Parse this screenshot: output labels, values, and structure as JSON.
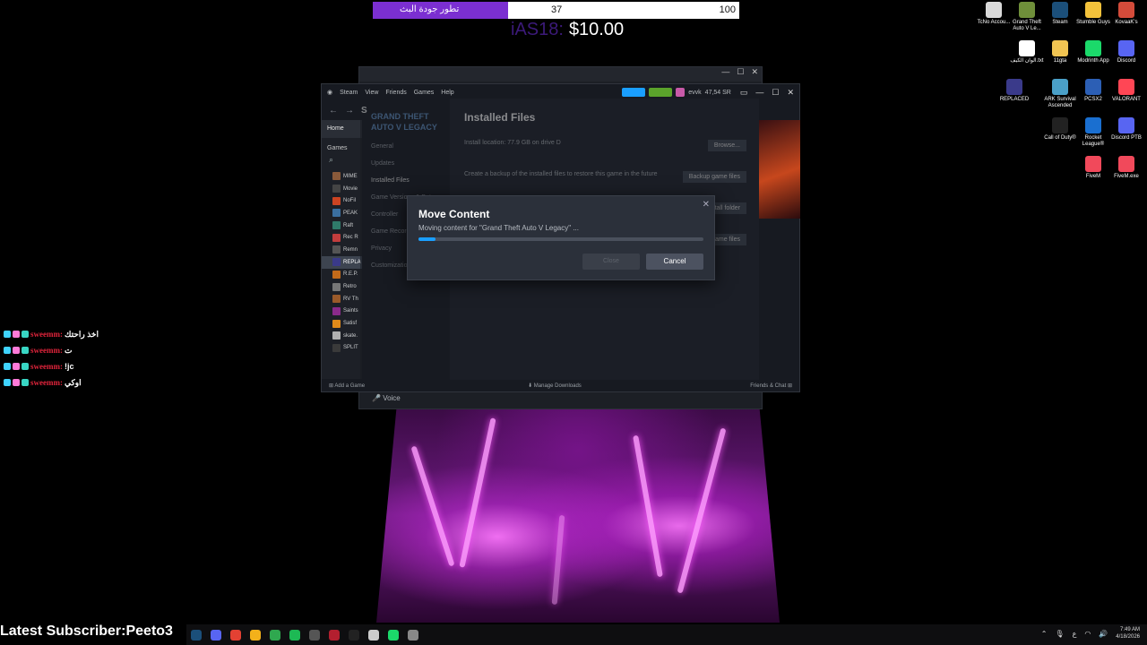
{
  "poll": {
    "label": "تطور جودة البث",
    "left_value": "37",
    "right_value": "100"
  },
  "donation": {
    "ghost_text": "iAS18:",
    "amount": "$10.00"
  },
  "desktop_icons": [
    {
      "label": "TcNo Accou...",
      "icon": "tcno-icon",
      "color": "#d9d9d9"
    },
    {
      "label": "Grand Theft Auto V Le...",
      "icon": "gta-icon",
      "color": "#6f8f3a"
    },
    {
      "label": "Steam",
      "icon": "steam-icon",
      "color": "#1b4f7a"
    },
    {
      "label": "Stumble Guys",
      "icon": "stumble-guys-icon",
      "color": "#f3c23b"
    },
    {
      "label": "KovaaK's",
      "icon": "kovaak-icon",
      "color": "#d34b3a"
    },
    {
      "label": "الوان الكيف.txt",
      "icon": "text-file-icon",
      "color": "#ffffff"
    },
    {
      "label": "11gta",
      "icon": "folder-icon",
      "color": "#f1c452"
    },
    {
      "label": "Modrinth App",
      "icon": "modrinth-icon",
      "color": "#1bd96a"
    },
    {
      "label": "Discord",
      "icon": "discord-icon",
      "color": "#5865f2"
    },
    {
      "label": "REPLACED",
      "icon": "replaced-icon",
      "color": "#3a3a8a"
    },
    {
      "label": "ARK Survival Ascended",
      "icon": "ark-icon",
      "color": "#4aa0c8"
    },
    {
      "label": "PCSX2",
      "icon": "pcsx2-icon",
      "color": "#2c5fb5"
    },
    {
      "label": "VALORANT",
      "icon": "valorant-icon",
      "color": "#ff4655"
    },
    {
      "label": "Call of Duty®",
      "icon": "call-of-duty-icon",
      "color": "#222222"
    },
    {
      "label": "Rocket League®",
      "icon": "rocket-league-icon",
      "color": "#1a6fd0"
    },
    {
      "label": "Discord PTB",
      "icon": "discord-ptb-icon",
      "color": "#5865f2"
    },
    {
      "label": "FiveM",
      "icon": "fivem-icon",
      "color": "#f1495b"
    },
    {
      "label": "FiveM.exe",
      "icon": "fivem-exe-icon",
      "color": "#f1495b"
    }
  ],
  "chat": [
    {
      "user": "sweemm:",
      "message": "اخذ راحتك"
    },
    {
      "user": "sweemm:",
      "message": "ت"
    },
    {
      "user": "sweemm:",
      "message": "!jc"
    },
    {
      "user": "sweemm:",
      "message": "اوكي"
    }
  ],
  "latest_subscriber": "Latest Subscriber:Peeto3",
  "back_window": {
    "voice_label": "Voice"
  },
  "steam": {
    "menu": [
      "Steam",
      "View",
      "Friends",
      "Games",
      "Help"
    ],
    "account": "evvk",
    "balance": "47,54 SR",
    "nav_initial": "S",
    "home_label": "Home",
    "games_label": "Games",
    "games": [
      {
        "name": "MIME",
        "color": "#8a5a3a"
      },
      {
        "name": "Movie",
        "color": "#444444"
      },
      {
        "name": "NoFil",
        "color": "#cc4422"
      },
      {
        "name": "PEAK",
        "color": "#3a6fa0"
      },
      {
        "name": "Raft",
        "color": "#2f7a6a"
      },
      {
        "name": "Rec R",
        "color": "#c23d3d"
      },
      {
        "name": "Remn",
        "color": "#555555"
      },
      {
        "name": "REPLA",
        "color": "#3a3a8a"
      },
      {
        "name": "R.E.P.",
        "color": "#c26a1a"
      },
      {
        "name": "Retro",
        "color": "#777777"
      },
      {
        "name": "RV Th",
        "color": "#9a5a2a"
      },
      {
        "name": "Saints",
        "color": "#8a2a8a"
      },
      {
        "name": "Satisf",
        "color": "#e08a1a"
      },
      {
        "name": "skate.",
        "color": "#b0b0b0"
      },
      {
        "name": "SPLIT",
        "color": "#3a3a3a"
      }
    ],
    "add_game": "Add a Game",
    "manage_downloads": "Manage Downloads",
    "friends_chat": "Friends & Chat"
  },
  "properties": {
    "game_title": "GRAND THEFT AUTO V LEGACY",
    "sections": [
      "General",
      "Updates",
      "Installed Files",
      "Game Versions & Betas",
      "Controller",
      "Game Recording",
      "Privacy",
      "Customization"
    ],
    "active_section": "Installed Files",
    "heading": "Installed Files",
    "location_text": "Install location: 77.9 GB on drive D",
    "browse_label": "Browse...",
    "backup_text": "Create a backup of the installed files to restore this game in the future",
    "backup_button": "Backup game files",
    "move_button": "Move install folder",
    "verify_button": "Verify integrity of game files"
  },
  "modal": {
    "title": "Move Content",
    "description": "Moving content for \"Grand Theft Auto V Legacy\" ...",
    "progress": 0.06,
    "ok_label": "Close",
    "cancel_label": "Cancel"
  },
  "taskbar": {
    "apps": [
      {
        "icon": "steam-taskbar-icon",
        "color": "#1b4f7a"
      },
      {
        "icon": "discord-taskbar-icon",
        "color": "#5865f2"
      },
      {
        "icon": "chrome-taskbar-icon",
        "color": "#e34133"
      },
      {
        "icon": "norton-taskbar-icon",
        "color": "#f3b11a"
      },
      {
        "icon": "xbox-taskbar-icon",
        "color": "#2fa84f"
      },
      {
        "icon": "spotify-taskbar-icon",
        "color": "#1db954"
      },
      {
        "icon": "app-taskbar-icon",
        "color": "#555555"
      },
      {
        "icon": "fivem-taskbar-icon",
        "color": "#b31f2f"
      },
      {
        "icon": "capcut-taskbar-icon",
        "color": "#222222"
      },
      {
        "icon": "obs-taskbar-icon",
        "color": "#cccccc"
      },
      {
        "icon": "modrinth-taskbar-icon",
        "color": "#1bd96a"
      },
      {
        "icon": "terminal-taskbar-icon",
        "color": "#888888"
      }
    ],
    "lang": "ع",
    "time": "7:49 AM",
    "date": "4/18/2026"
  }
}
